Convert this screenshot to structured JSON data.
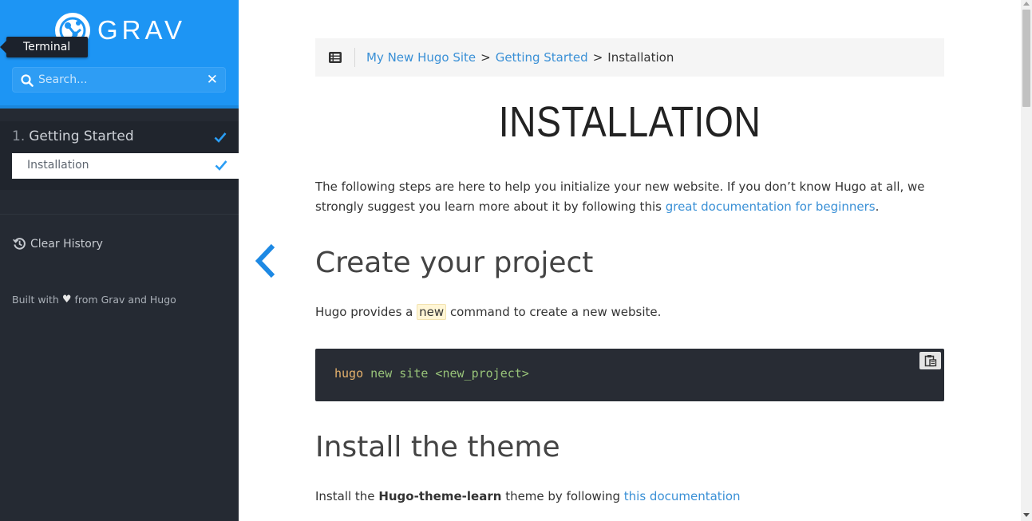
{
  "sidebar": {
    "logo_text": "GRAV",
    "tooltip": "Terminal",
    "search": {
      "placeholder": "Search...",
      "value": "",
      "clear_glyph": "✕"
    },
    "section": {
      "number": "1.",
      "label": "Getting Started"
    },
    "active_item": {
      "label": "Installation"
    },
    "clear_history": "Clear History",
    "built_with": {
      "prefix": "Built with",
      "heart": "♥",
      "suffix": "from Grav and Hugo"
    }
  },
  "breadcrumbs": {
    "items": [
      {
        "label": "My New Hugo Site",
        "link": true
      },
      {
        "label": "Getting Started",
        "link": true
      },
      {
        "label": "Installation",
        "link": false
      }
    ],
    "separator": ">"
  },
  "page": {
    "title": "INSTALLATION",
    "intro_text": "The following steps are here to help you initialize your new website. If you don’t know Hugo at all, we strongly suggest you learn more about it by following this",
    "intro_link": "great documentation for beginners",
    "intro_end": ".",
    "section1_heading": "Create your project",
    "section1_text_before": "Hugo provides a",
    "section1_code": "new",
    "section1_text_after": "command to create a new website.",
    "code": {
      "cmd": "hugo",
      "args": "new site <new_project>"
    },
    "section2_heading": "Install the theme",
    "section2_text_before": "Install the",
    "section2_bold": "Hugo-theme-learn",
    "section2_text_mid": "theme by following",
    "section2_link": "this documentation"
  },
  "icons": {
    "logo": "grav-logo-icon",
    "search": "search-icon",
    "check": "check-icon",
    "history": "history-icon",
    "toc": "list-icon",
    "prev": "chevron-left-icon",
    "copy": "clipboard-icon"
  },
  "colors": {
    "sidebar_bg": "#252a33",
    "header_blue": "#1d95f4",
    "link": "#3a90d6",
    "code_bg": "#282c34"
  }
}
